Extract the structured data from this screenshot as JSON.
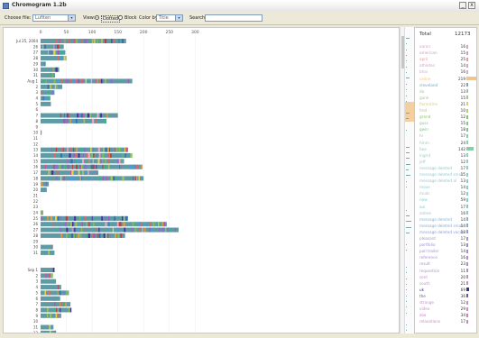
{
  "window": {
    "title": "Chromogram 1.2b",
    "btn_min": "_",
    "btn_close": "x"
  },
  "toolbar": {
    "choose_file_label": "Choose file:",
    "choose_file_value": "Lufiten",
    "view_label": "View:",
    "view_options": [
      "Dotted",
      "Block"
    ],
    "color_by_label": "Color by:",
    "color_by_value": "Title",
    "search_label": "Search:",
    "search_value": ""
  },
  "colors": {
    "default_bar": "#5f9ba5",
    "highlight": "#f3c488"
  },
  "chart_data": {
    "type": "timeline-bar",
    "x_ticks": [
      "0",
      "50",
      "100",
      "150",
      "200",
      "250",
      "300"
    ],
    "xlim": [
      0,
      330
    ],
    "rows": [
      {
        "label": "Jul 25, 2004",
        "value": 166
      },
      {
        "label": "26",
        "value": 45
      },
      {
        "label": "27",
        "value": 48
      },
      {
        "label": "28",
        "value": 50
      },
      {
        "label": "29",
        "value": 10
      },
      {
        "label": "30",
        "value": 36
      },
      {
        "label": "31",
        "value": 28
      },
      {
        "label": "Aug 1",
        "value": 178
      },
      {
        "label": "2",
        "value": 42
      },
      {
        "label": "3",
        "value": 27
      },
      {
        "label": "4",
        "value": 19
      },
      {
        "label": "5",
        "value": 20
      },
      {
        "label": "6",
        "value": 0
      },
      {
        "label": "7",
        "value": 150
      },
      {
        "label": "8",
        "value": 128
      },
      {
        "label": "9",
        "value": 0
      },
      {
        "label": "10",
        "value": 2
      },
      {
        "label": "11",
        "value": 0
      },
      {
        "label": "12",
        "value": 0
      },
      {
        "label": "13",
        "value": 170
      },
      {
        "label": "14",
        "value": 178
      },
      {
        "label": "15",
        "value": 162
      },
      {
        "label": "16",
        "value": 198
      },
      {
        "label": "17",
        "value": 112
      },
      {
        "label": "18",
        "value": 200
      },
      {
        "label": "19",
        "value": 16
      },
      {
        "label": "20",
        "value": 12
      },
      {
        "label": "21",
        "value": 0
      },
      {
        "label": "22",
        "value": 0
      },
      {
        "label": "23",
        "value": 0
      },
      {
        "label": "24",
        "value": 5
      },
      {
        "label": "25",
        "value": 170
      },
      {
        "label": "26",
        "value": 245
      },
      {
        "label": "27",
        "value": 268
      },
      {
        "label": "28",
        "value": 164
      },
      {
        "label": "29",
        "value": 0
      },
      {
        "label": "30",
        "value": 24
      },
      {
        "label": "31",
        "value": 27
      },
      {
        "label": "",
        "value": 0
      },
      {
        "label": "",
        "value": 0
      },
      {
        "label": "Sep 1",
        "value": 27
      },
      {
        "label": "2",
        "value": 24
      },
      {
        "label": "3",
        "value": 30
      },
      {
        "label": "4",
        "value": 40
      },
      {
        "label": "5",
        "value": 55
      },
      {
        "label": "6",
        "value": 38
      },
      {
        "label": "7",
        "value": 58
      },
      {
        "label": "8",
        "value": 60
      },
      {
        "label": "9",
        "value": 40
      },
      {
        "label": "10",
        "value": 0
      },
      {
        "label": "11",
        "value": 25
      },
      {
        "label": "12",
        "value": 30
      }
    ]
  },
  "title_list": {
    "total_label": "Total",
    "total_value": "12173",
    "items": [
      {
        "name": "aaron",
        "count": "16",
        "color": "#d9a3b3",
        "frac": 0.02
      },
      {
        "name": "american",
        "count": "15",
        "color": "#c7a0c9",
        "frac": 0.02
      },
      {
        "name": "april",
        "count": "25",
        "color": "#e0a097",
        "frac": 0.03
      },
      {
        "name": "athletes",
        "count": "14",
        "color": "#d2a5c2",
        "frac": 0.02
      },
      {
        "name": "bhai",
        "count": "16",
        "color": "#c9b1c8",
        "frac": 0.02
      },
      {
        "name": "celine",
        "count": "219",
        "color": "#f0c48c",
        "frac": 0.6
      },
      {
        "name": "cleveland",
        "count": "22",
        "color": "#7ea4b8",
        "frac": 0.03
      },
      {
        "name": "da",
        "count": "13",
        "color": "#9fc3a6",
        "frac": 0.02
      },
      {
        "name": "gunk",
        "count": "15",
        "color": "#a9c48d",
        "frac": 0.02
      },
      {
        "name": "florentine",
        "count": "21",
        "color": "#d7cf82",
        "frac": 0.03
      },
      {
        "name": "fred",
        "count": "10",
        "color": "#b2c78a",
        "frac": 0.01
      },
      {
        "name": "grand",
        "count": "12",
        "color": "#8fbf71",
        "frac": 0.02
      },
      {
        "name": "guss",
        "count": "15",
        "color": "#8cc48d",
        "frac": 0.02
      },
      {
        "name": "gwin",
        "count": "18",
        "color": "#7fc18a",
        "frac": 0.02
      },
      {
        "name": "hi",
        "count": "17",
        "color": "#90cba2",
        "frac": 0.02
      },
      {
        "name": "hmm",
        "count": "24",
        "color": "#8fd1a8",
        "frac": 0.03
      },
      {
        "name": "hoe",
        "count": "142",
        "color": "#86cfa6",
        "frac": 0.4
      },
      {
        "name": "ingrid",
        "count": "13",
        "color": "#92cdbb",
        "frac": 0.02
      },
      {
        "name": "jeff",
        "count": "12",
        "color": "#9acbc4",
        "frac": 0.02
      },
      {
        "name": "message deleted",
        "count": "17",
        "color": "#8fcac9",
        "frac": 0.02
      },
      {
        "name": "message deleted small",
        "count": "15",
        "color": "#9ac8d0",
        "frac": 0.02
      },
      {
        "name": "message deleted al",
        "count": "13",
        "color": "#96c4cf",
        "frac": 0.02
      },
      {
        "name": "move",
        "count": "14",
        "color": "#90c6d2",
        "frac": 0.02
      },
      {
        "name": "mudc",
        "count": "12",
        "color": "#8ed0c8",
        "frac": 0.02
      },
      {
        "name": "now",
        "count": "59",
        "color": "#79d1c7",
        "frac": 0.12
      },
      {
        "name": "oui",
        "count": "17",
        "color": "#86c7ce",
        "frac": 0.02
      },
      {
        "name": "online",
        "count": "16",
        "color": "#98bfd0",
        "frac": 0.02
      },
      {
        "name": "message deleted",
        "count": "14",
        "color": "#8ab3d1",
        "frac": 0.02
      },
      {
        "name": "message deleted small",
        "count": "14",
        "color": "#8aa8d1",
        "frac": 0.02
      },
      {
        "name": "message deleted vacat",
        "count": "18",
        "color": "#8f9fd0",
        "frac": 0.02
      },
      {
        "name": "pleasant",
        "count": "17",
        "color": "#9a99cd",
        "frac": 0.02
      },
      {
        "name": "portfolio",
        "count": "13",
        "color": "#9a91cc",
        "frac": 0.02
      },
      {
        "name": "pull trailer",
        "count": "14",
        "color": "#a38fcb",
        "frac": 0.02
      },
      {
        "name": "reference",
        "count": "16",
        "color": "#b08ccb",
        "frac": 0.02
      },
      {
        "name": "result",
        "count": "23",
        "color": "#b58dc6",
        "frac": 0.03
      },
      {
        "name": "requestion",
        "count": "11",
        "color": "#b98fc9",
        "frac": 0.01
      },
      {
        "name": "sent",
        "count": "20",
        "color": "#c28fc8",
        "frac": 0.03
      },
      {
        "name": "south",
        "count": "21",
        "color": "#c595c4",
        "frac": 0.03
      },
      {
        "name": "uk",
        "count": "69",
        "color": "#3b2f8f",
        "frac": 0.16
      },
      {
        "name": "the",
        "count": "36",
        "color": "#6b55a8",
        "frac": 0.04
      },
      {
        "name": "strange",
        "count": "12",
        "color": "#c690c7",
        "frac": 0.02
      },
      {
        "name": "video",
        "count": "29",
        "color": "#c78ec4",
        "frac": 0.03
      },
      {
        "name": "zoo",
        "count": "34",
        "color": "#cc7fbd",
        "frac": 0.04
      },
      {
        "name": "relaxations",
        "count": "17",
        "color": "#c98ac9",
        "frac": 0.02
      }
    ]
  }
}
